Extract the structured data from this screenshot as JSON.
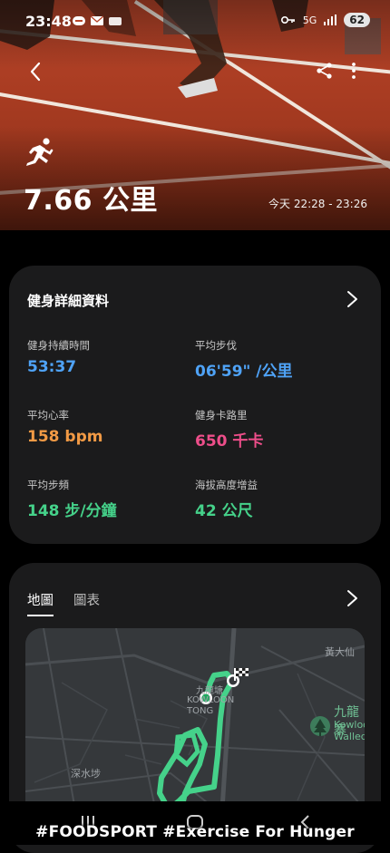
{
  "status_bar": {
    "time": "23:48",
    "network": "5G",
    "battery": "62"
  },
  "hero": {
    "distance": "7.66 公里",
    "time_range": "今天 22:28 - 23:26",
    "activity_icon": "running-icon"
  },
  "details_card": {
    "title": "健身詳細資料",
    "stats": [
      {
        "label": "健身持續時間",
        "value": "53:37",
        "color": "#4fa3f7"
      },
      {
        "label": "平均步伐",
        "value": "06'59\" /公里",
        "color": "#4fa3f7"
      },
      {
        "label": "平均心率",
        "value": "158 bpm",
        "color": "#f29a45"
      },
      {
        "label": "健身卡路里",
        "value": "650 千卡",
        "color": "#ee4e8a"
      },
      {
        "label": "平均步頻",
        "value": "148 步/分鐘",
        "color": "#45d28a"
      },
      {
        "label": "海拔高度增益",
        "value": "42 公尺",
        "color": "#45d28a"
      }
    ]
  },
  "map_card": {
    "tabs": [
      {
        "label": "地圖",
        "active": true
      },
      {
        "label": "圖表",
        "active": false
      }
    ],
    "map_labels": {
      "wong_tai_sin": "黃大仙",
      "kowloon_tong_cn": "九龍塘",
      "kowloon_tong_en": "KOWLOON TONG",
      "kowloon_cn": "九龍寨",
      "kowloon_walled_city_en": "Kowloon Walled City P",
      "sham_shui_po": "深水埗"
    },
    "route_color": "#45d28a"
  },
  "caption": "#FOODSPORT  #Exercise  For Hunger"
}
